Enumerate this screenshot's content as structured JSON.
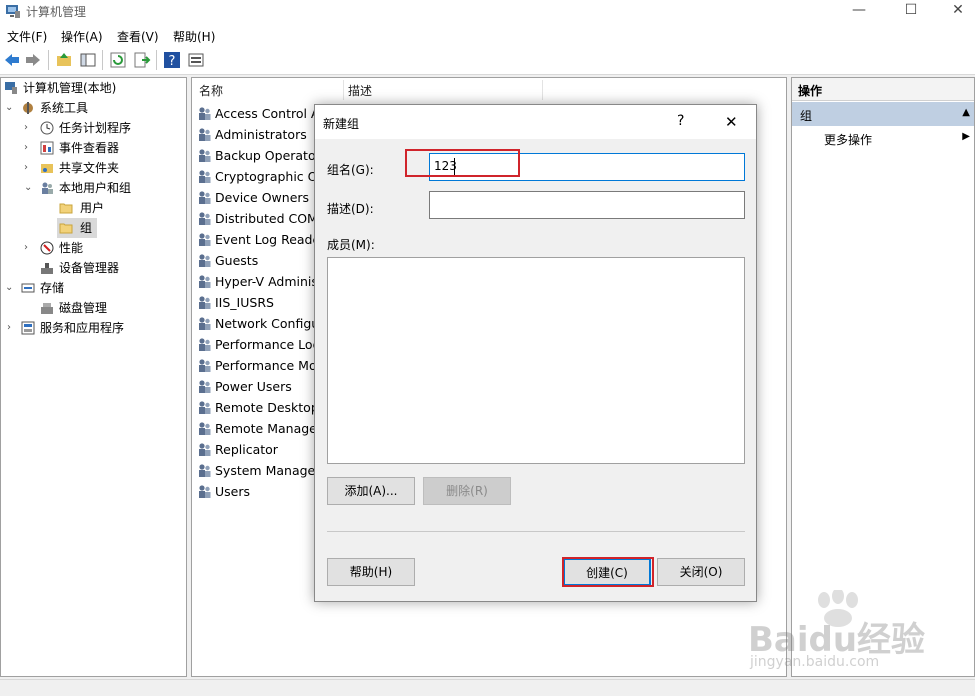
{
  "window": {
    "title": "计算机管理",
    "minimize": "—",
    "maximize": "☐",
    "close": "✕"
  },
  "menu": [
    "文件(F)",
    "操作(A)",
    "查看(V)",
    "帮助(H)"
  ],
  "toolbar_icons": [
    "back-arrow-icon",
    "forward-arrow-icon",
    "up-folder-icon",
    "show-hide-tree-icon",
    "refresh-icon",
    "export-list-icon",
    "help-icon",
    "properties-icon"
  ],
  "tree": {
    "items": [
      {
        "label": "计算机管理(本地)",
        "icon": "computer-management-icon"
      },
      {
        "label": "系统工具",
        "icon": "system-tools-icon"
      },
      {
        "label": "任务计划程序",
        "icon": "clock-icon"
      },
      {
        "label": "事件查看器",
        "icon": "event-viewer-icon"
      },
      {
        "label": "共享文件夹",
        "icon": "shared-folder-icon"
      },
      {
        "label": "本地用户和组",
        "icon": "users-icon"
      },
      {
        "label": "用户",
        "icon": "folder-icon"
      },
      {
        "label": "组",
        "icon": "folder-icon"
      },
      {
        "label": "性能",
        "icon": "performance-icon"
      },
      {
        "label": "设备管理器",
        "icon": "device-manager-icon"
      },
      {
        "label": "存储",
        "icon": "storage-icon"
      },
      {
        "label": "磁盘管理",
        "icon": "disk-icon"
      },
      {
        "label": "服务和应用程序",
        "icon": "services-icon"
      }
    ]
  },
  "list": {
    "headers": {
      "name": "名称",
      "desc": "描述"
    },
    "rows": [
      "Access Control As",
      "Administrators",
      "Backup Operator",
      "Cryptographic Op",
      "Device Owners",
      "Distributed COM",
      "Event Log Reader",
      "Guests",
      "Hyper-V Administ",
      "IIS_IUSRS",
      "Network Configu",
      "Performance Log",
      "Performance Mon",
      "Power Users",
      "Remote Desktop",
      "Remote Manager",
      "Replicator",
      "System Managed",
      "Users"
    ]
  },
  "actions": {
    "header": "操作",
    "group": "组",
    "more": "更多操作"
  },
  "dialog": {
    "title": "新建组",
    "help_glyph": "?",
    "close_glyph": "✕",
    "group_name_label": "组名(G):",
    "group_name_value": "123",
    "description_label": "描述(D):",
    "description_value": "",
    "members_label": "成员(M):",
    "add_button": "添加(A)...",
    "remove_button": "删除(R)",
    "help_button": "帮助(H)",
    "create_button": "创建(C)",
    "close_button": "关闭(O)"
  },
  "watermark": {
    "brand": "Baidu经验",
    "url": "jingyan.baidu.com"
  },
  "colors": {
    "highlight": "#d0242b",
    "selection": "#bfcfe2",
    "accent": "#0078d7"
  }
}
